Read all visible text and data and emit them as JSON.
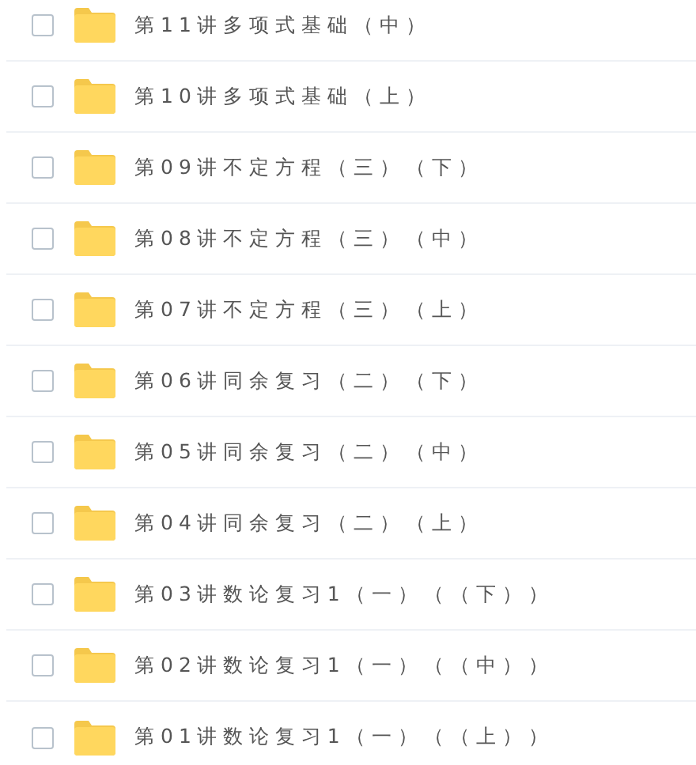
{
  "files": [
    {
      "name": "第11讲多项式基础（中）",
      "checked": false
    },
    {
      "name": "第10讲多项式基础（上）",
      "checked": false
    },
    {
      "name": "第09讲不定方程（三）（下）",
      "checked": false
    },
    {
      "name": "第08讲不定方程（三）（中）",
      "checked": false
    },
    {
      "name": "第07讲不定方程（三）（上）",
      "checked": false
    },
    {
      "name": "第06讲同余复习（二）（下）",
      "checked": false
    },
    {
      "name": "第05讲同余复习（二）（中）",
      "checked": false
    },
    {
      "name": "第04讲同余复习（二）（上）",
      "checked": false
    },
    {
      "name": "第03讲数论复习1（一）（（下））",
      "checked": false
    },
    {
      "name": "第02讲数论复习1（一）（（中））",
      "checked": false
    },
    {
      "name": "第01讲数论复习1（一）（（上））",
      "checked": false
    }
  ]
}
